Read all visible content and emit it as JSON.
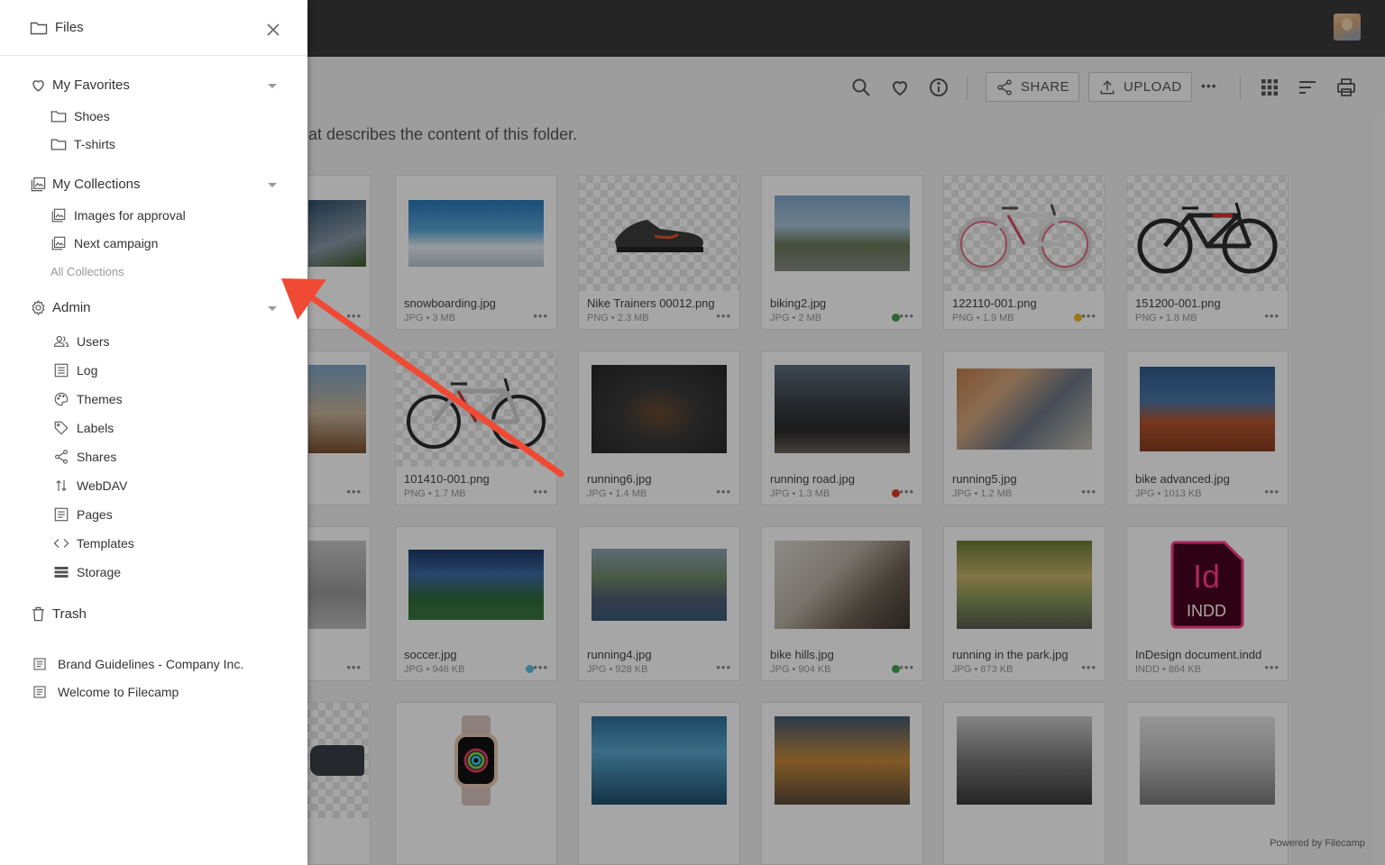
{
  "topbar": {
    "avatar_alt": "user-avatar"
  },
  "toolbar": {
    "share_label": "SHARE",
    "upload_label": "UPLOAD",
    "more_label": "•••"
  },
  "folder_description": "at describes the content of this folder.",
  "drawer": {
    "title": "Files",
    "favorites": {
      "label": "My Favorites",
      "items": [
        "Shoes",
        "T-shirts"
      ]
    },
    "collections": {
      "label": "My Collections",
      "items": [
        "Images for approval",
        "Next campaign"
      ],
      "all_label": "All Collections"
    },
    "admin": {
      "label": "Admin",
      "items": [
        "Users",
        "Log",
        "Themes",
        "Labels",
        "Shares",
        "WebDAV",
        "Pages",
        "Templates",
        "Storage"
      ]
    },
    "trash_label": "Trash",
    "pages": [
      "Brand Guidelines - Company Inc.",
      "Welcome to Filecamp"
    ]
  },
  "files": [
    {
      "name": "snowboarding.jpg",
      "meta": "JPG • 3 MB"
    },
    {
      "name": "Nike Trainers 00012.png",
      "meta": "PNG • 2.3 MB"
    },
    {
      "name": "biking2.jpg",
      "meta": "JPG • 2 MB",
      "label_color": "#3fa34a"
    },
    {
      "name": "122110-001.png",
      "meta": "PNG • 1.9 MB",
      "label_color": "#e8b923"
    },
    {
      "name": "151200-001.png",
      "meta": "PNG • 1.8 MB"
    },
    {
      "name": "101410-001.png",
      "meta": "PNG • 1.7 MB"
    },
    {
      "name": "running6.jpg",
      "meta": "JPG • 1.4 MB"
    },
    {
      "name": "running road.jpg",
      "meta": "JPG • 1.3 MB",
      "label_color": "#e0352b"
    },
    {
      "name": "running5.jpg",
      "meta": "JPG • 1.2 MB"
    },
    {
      "name": "bike advanced.jpg",
      "meta": "JPG • 1013 KB"
    },
    {
      "name": "soccer.jpg",
      "meta": "JPG • 946 KB",
      "label_color": "#5bc0de"
    },
    {
      "name": "running4.jpg",
      "meta": "JPG • 928 KB"
    },
    {
      "name": "bike hills.jpg",
      "meta": "JPG • 904 KB",
      "label_color": "#3fa34a"
    },
    {
      "name": "running in the park.jpg",
      "meta": "JPG • 873 KB"
    },
    {
      "name": "InDesign document.indd",
      "meta": "INDD • 864 KB"
    }
  ],
  "indd_icon": {
    "top": "Id",
    "bottom": "INDD"
  },
  "card_more": "•••",
  "powered_by": "Powered by Filecamp",
  "colors": {
    "accent_arrow": "#f04a35",
    "topbar": "#3a3a3a",
    "indd_brand": "#49021f"
  }
}
